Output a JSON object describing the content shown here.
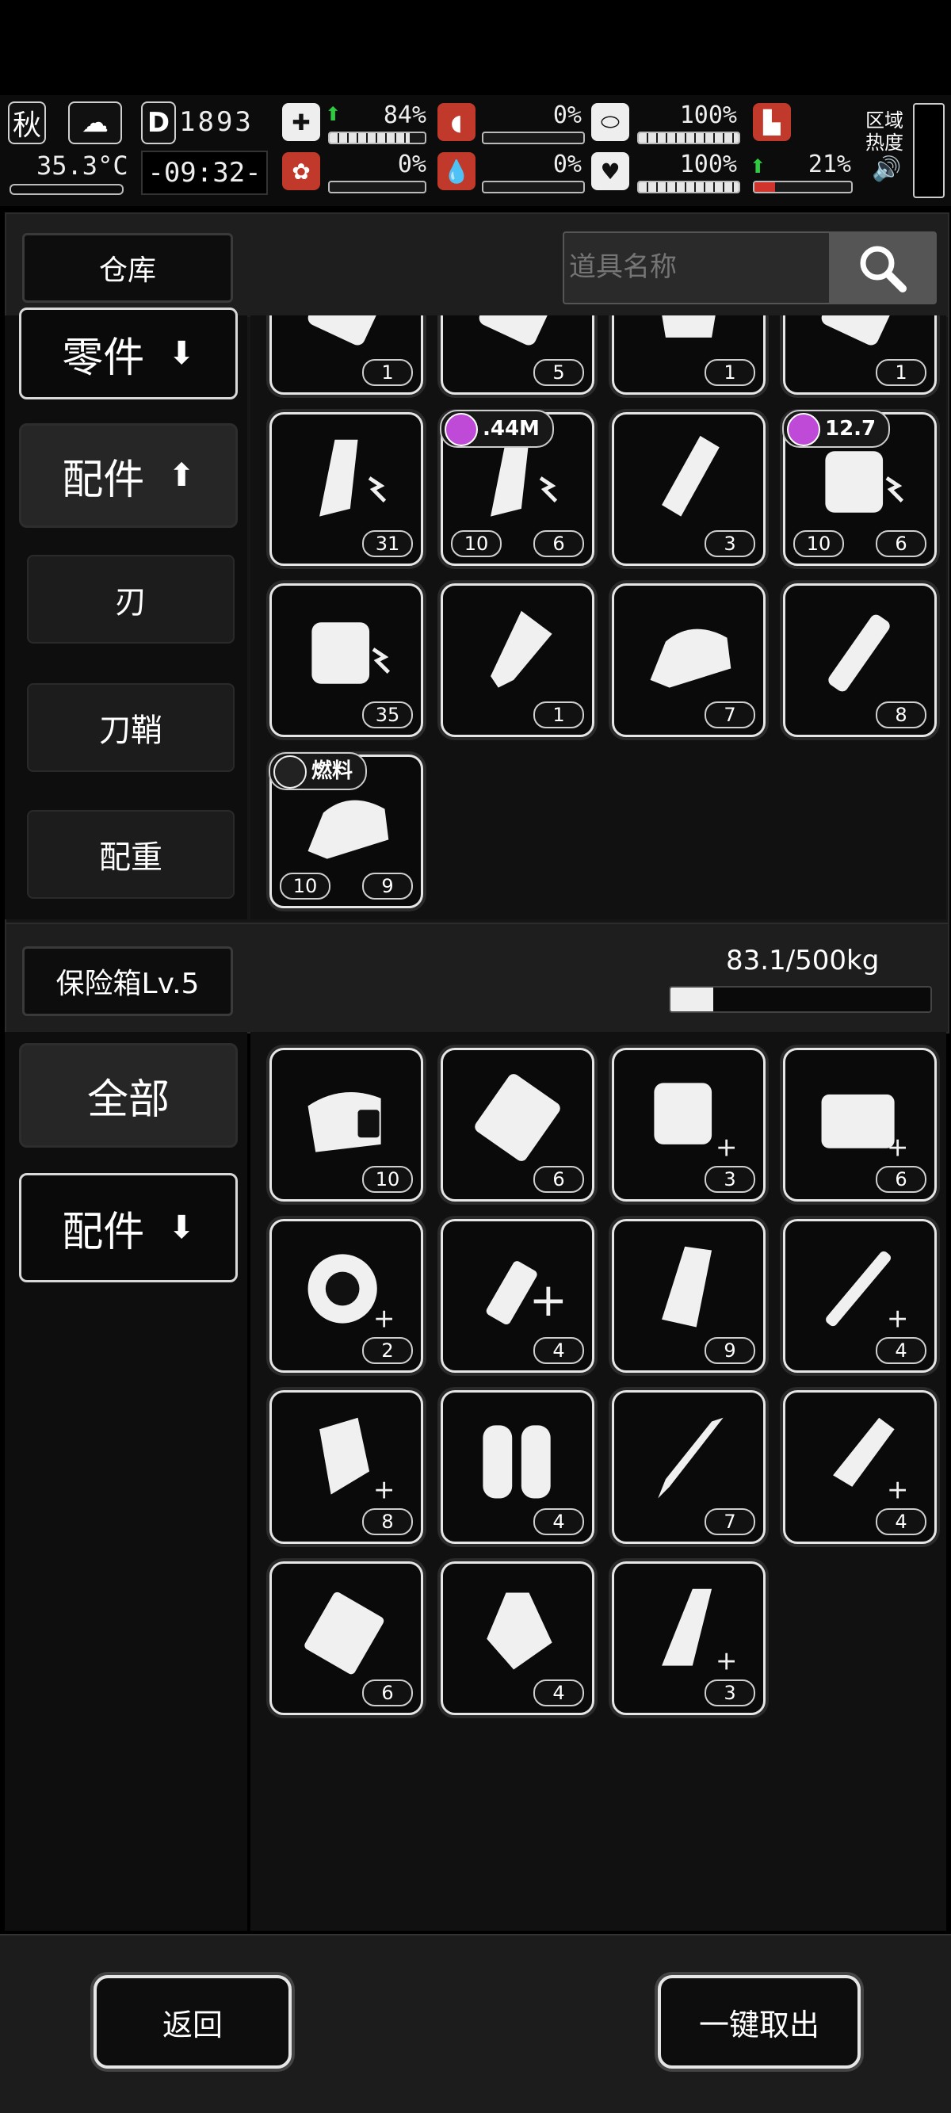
{
  "hud": {
    "season": "秋",
    "temperature": "35.3°C",
    "day": "1893",
    "time": "-09:32-",
    "stats": [
      {
        "id": "health",
        "value": "84%",
        "level": 0.84,
        "icon": "medkit-icon"
      },
      {
        "id": "hunger",
        "value": "0%",
        "level": 0,
        "icon": "stomach-icon"
      },
      {
        "id": "thirst_drink",
        "value": "100%",
        "level": 1.0,
        "icon": "capsule-icon"
      },
      {
        "id": "brain",
        "value": "0%",
        "level": 0,
        "icon": "brain-icon"
      },
      {
        "id": "blood",
        "value": "0%",
        "level": 0,
        "icon": "blood-drop-icon"
      },
      {
        "id": "mood",
        "value": "100%",
        "level": 1.0,
        "icon": "heart-icon"
      },
      {
        "id": "stamina",
        "value": "21%",
        "level": 0.21,
        "icon": "boot-icon"
      }
    ],
    "zone_heat_label": "区域\n热度"
  },
  "warehouse": {
    "title": "仓库",
    "search_placeholder": "道具名称",
    "categories": [
      {
        "label": "零件",
        "arrow": "down"
      },
      {
        "label": "配件",
        "arrow": "up"
      }
    ],
    "subcategories": [
      "刃",
      "刀鞘",
      "配重"
    ],
    "items": [
      {
        "count": "1",
        "icon": "part-top-icon"
      },
      {
        "count": "5",
        "icon": "blade-top-icon"
      },
      {
        "count": "1",
        "icon": "weight-plate-icon"
      },
      {
        "count": "1",
        "icon": "part-top2-icon"
      },
      {
        "count": "31",
        "icon": "battery-magazine-icon"
      },
      {
        "count": "6",
        "count2": "10",
        "badge": ".44M",
        "icon": "battery-magazine-icon"
      },
      {
        "count": "3",
        "icon": "knife-magazine-icon"
      },
      {
        "count": "6",
        "count2": "10",
        "badge": "12.7",
        "icon": "drum-battery-icon"
      },
      {
        "count": "35",
        "icon": "drum-battery-icon"
      },
      {
        "count": "1",
        "icon": "flashlight-icon"
      },
      {
        "count": "7",
        "icon": "fuel-tank-icon"
      },
      {
        "count": "8",
        "icon": "tube-icon"
      },
      {
        "count": "9",
        "count2": "10",
        "badge": "燃料",
        "badge_type": "image",
        "icon": "fuel-tank-icon"
      }
    ]
  },
  "safe": {
    "title": "保险箱Lv.5",
    "weight": "83.1/500kg",
    "weight_level": 0.166,
    "categories": [
      {
        "label": "全部",
        "arrow": ""
      },
      {
        "label": "配件",
        "arrow": "down"
      }
    ],
    "items": [
      {
        "count": "10",
        "icon": "canister-x-icon"
      },
      {
        "count": "6",
        "icon": "rail-plate-icon"
      },
      {
        "count": "3",
        "icon": "drum-plus-icon"
      },
      {
        "count": "6",
        "icon": "case-up-icon"
      },
      {
        "count": "2",
        "icon": "shield-plus-icon"
      },
      {
        "count": "4",
        "icon": "tube-plus-icon"
      },
      {
        "count": "9",
        "icon": "curved-magazine-icon"
      },
      {
        "count": "4",
        "icon": "barrel-up-icon"
      },
      {
        "count": "8",
        "icon": "mag-up-icon"
      },
      {
        "count": "4",
        "icon": "twin-tank-icon"
      },
      {
        "count": "7",
        "icon": "blade-icon"
      },
      {
        "count": "4",
        "icon": "grip-up-icon"
      },
      {
        "count": "6",
        "icon": "box-icon"
      },
      {
        "count": "4",
        "icon": "bottle-icon"
      },
      {
        "count": "3",
        "icon": "mag-up2-icon"
      }
    ]
  },
  "footer": {
    "back": "返回",
    "take_all": "一键取出"
  }
}
